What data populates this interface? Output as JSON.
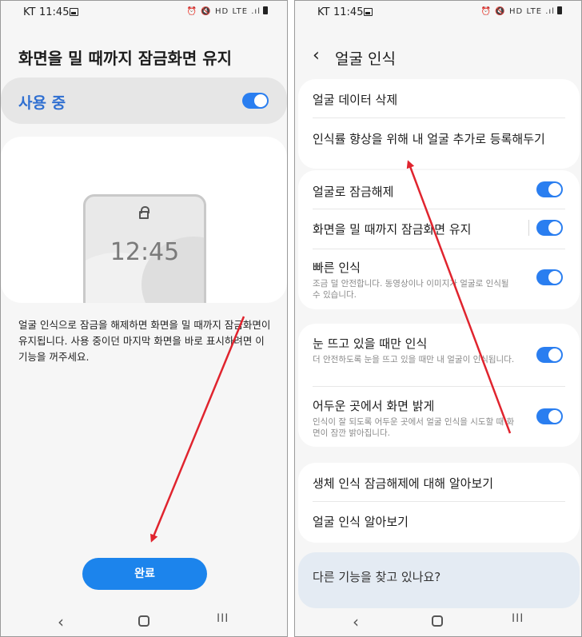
{
  "status_bar": {
    "carrier": "KT",
    "time": "11:45",
    "network": "LTE"
  },
  "left_screen": {
    "title": "화면을 밀 때까지 잠금화면 유지",
    "main_switch": {
      "label": "사용 중",
      "on": true
    },
    "illustration_clock": "12:45",
    "description": "얼굴 인식으로 잠금을 해제하면 화면을 밀 때까지 잠금화면이 유지됩니다. 사용 중이던 마지막 화면을 바로 표시하려면 이 기능을 꺼주세요.",
    "done_label": "완료"
  },
  "right_screen": {
    "title": "얼굴 인식",
    "group1": [
      {
        "label": "얼굴 데이터 삭제"
      },
      {
        "label": "인식률 향상을 위해 내 얼굴 추가로 등록해두기"
      }
    ],
    "group2": [
      {
        "label": "얼굴로 잠금해제",
        "on": true
      },
      {
        "label": "화면을 밀 때까지 잠금화면 유지",
        "on": true
      },
      {
        "label": "빠른 인식",
        "sub": "조금 덜 안전합니다. 동영상이나 이미지가 얼굴로 인식될 수 있습니다.",
        "on": true
      }
    ],
    "group3": [
      {
        "label": "눈 뜨고 있을 때만 인식",
        "sub": "더 안전하도록 눈을 뜨고 있을 때만 내 얼굴이 인식됩니다.",
        "on": true
      },
      {
        "label": "어두운 곳에서 화면 밝게",
        "sub": "인식이 잘 되도록 어두운 곳에서 얼굴 인식을 시도할 때 화면이 잠깐 밝아집니다.",
        "on": true
      }
    ],
    "group4": [
      {
        "label": "생체 인식 잠금해제에 대해 알아보기"
      },
      {
        "label": "얼굴 인식 알아보기"
      }
    ],
    "help_title": "다른 기능을 찾고 있나요?"
  },
  "nav_bar": {
    "back": "‹",
    "recents": "III"
  },
  "colors": {
    "accent": "#1c84ec",
    "toggle_on": "#2a7ef0",
    "annotation_arrow": "#e0242e"
  },
  "icons": [
    "gallery-icon",
    "battery-icon",
    "lock-icon",
    "back-arrow-icon",
    "home-icon",
    "recents-icon"
  ]
}
